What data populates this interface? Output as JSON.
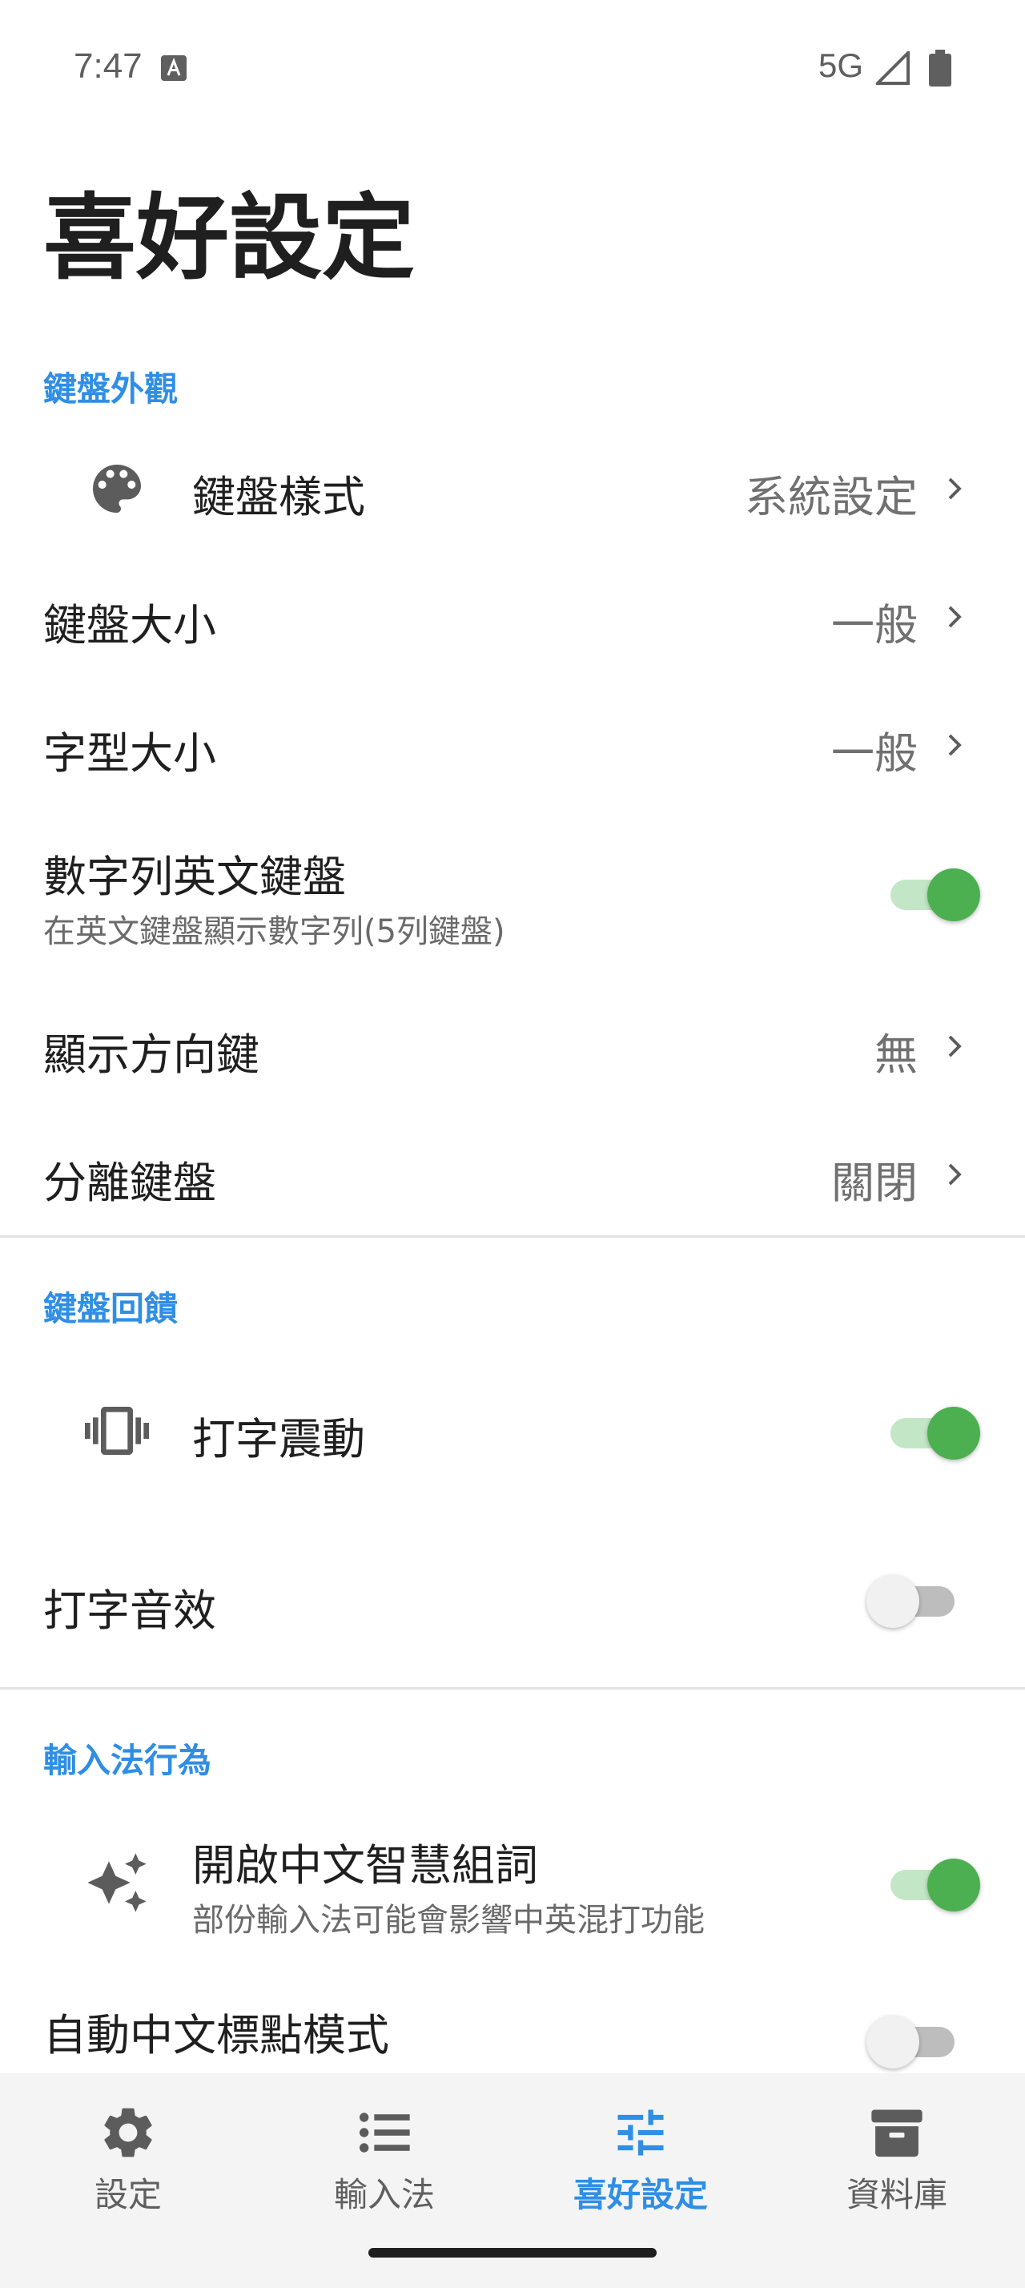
{
  "status_bar": {
    "time": "7:47",
    "network": "5G"
  },
  "page": {
    "title": "喜好設定"
  },
  "sections": {
    "appearance": {
      "header": "鍵盤外觀",
      "keyboard_style": {
        "title": "鍵盤樣式",
        "value": "系統設定",
        "icon": "palette-icon"
      },
      "keyboard_size": {
        "title": "鍵盤大小",
        "value": "一般"
      },
      "font_size": {
        "title": "字型大小",
        "value": "一般"
      },
      "number_row": {
        "title": "數字列英文鍵盤",
        "subtitle": "在英文鍵盤顯示數字列(5列鍵盤)",
        "enabled": true
      },
      "arrow_keys": {
        "title": "顯示方向鍵",
        "value": "無"
      },
      "split_keyboard": {
        "title": "分離鍵盤",
        "value": "關閉"
      }
    },
    "feedback": {
      "header": "鍵盤回饋",
      "vibration": {
        "title": "打字震動",
        "enabled": true,
        "icon": "vibration-icon"
      },
      "sound": {
        "title": "打字音效",
        "enabled": false
      }
    },
    "behavior": {
      "header": "輸入法行為",
      "smart_phrase": {
        "title": "開啟中文智慧組詞",
        "subtitle": "部份輸入法可能會影響中英混打功能",
        "enabled": true,
        "icon": "sparkle-icon"
      },
      "auto_punctuation": {
        "title": "自動中文標點模式",
        "enabled": false
      }
    }
  },
  "bottom_nav": {
    "items": [
      {
        "label": "設定",
        "icon": "gear-icon",
        "active": false
      },
      {
        "label": "輸入法",
        "icon": "list-icon",
        "active": false
      },
      {
        "label": "喜好設定",
        "icon": "sliders-icon",
        "active": true
      },
      {
        "label": "資料庫",
        "icon": "archive-icon",
        "active": false
      }
    ]
  },
  "colors": {
    "accent": "#2f8ee5",
    "toggle_on": "#4caf50",
    "toggle_off": "#f1f1f1"
  }
}
